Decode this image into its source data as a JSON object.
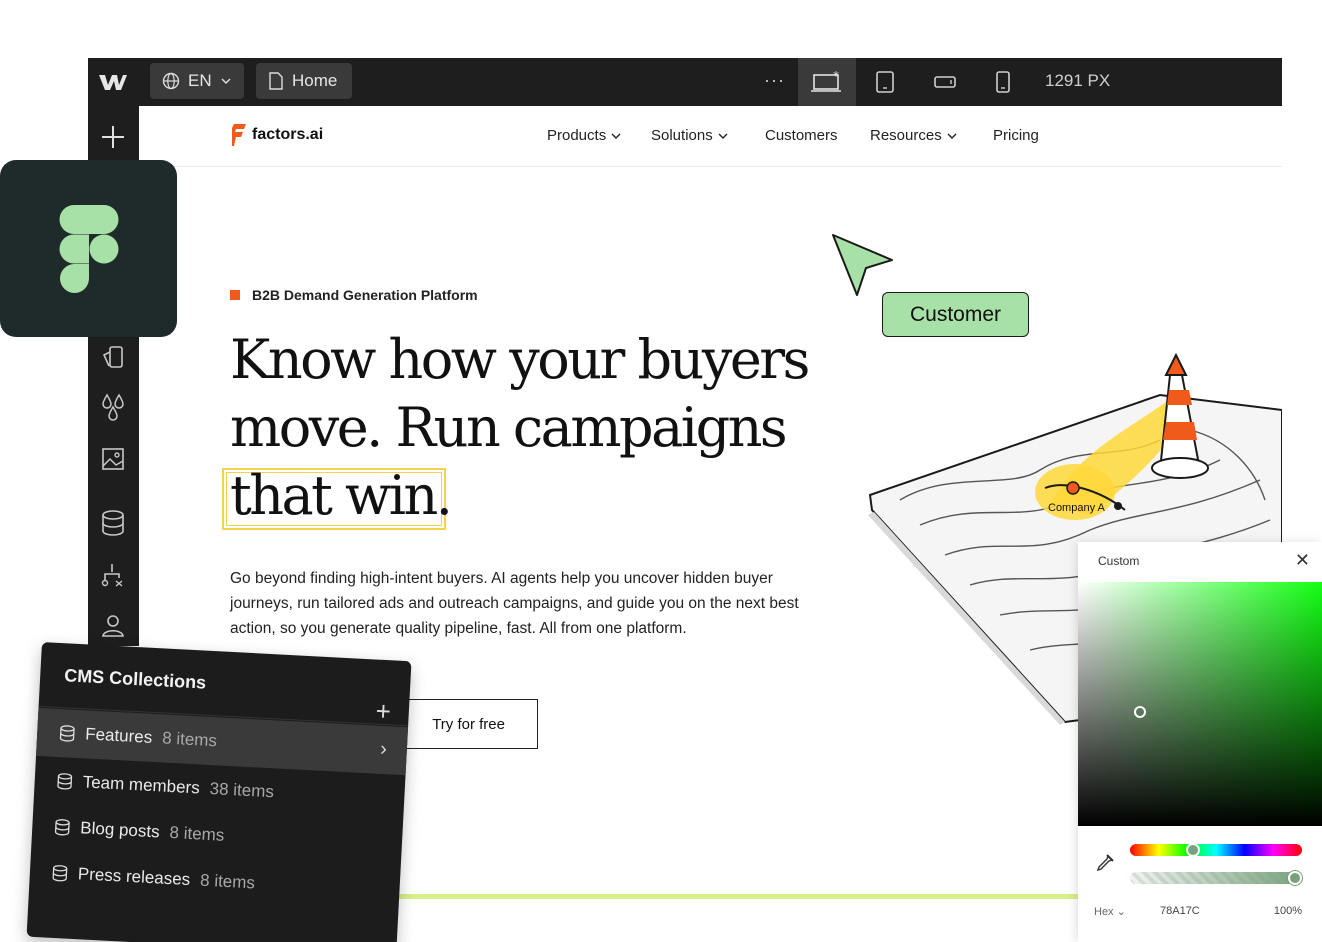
{
  "toolbar": {
    "language": "EN",
    "page": "Home",
    "more": "···",
    "width_readout": "1291 PX"
  },
  "site": {
    "brand": "factors.ai",
    "nav": [
      "Products",
      "Solutions",
      "Customers",
      "Resources",
      "Pricing"
    ],
    "eyebrow": "B2B Demand Generation Platform",
    "headline_line1": "Know how your buyers",
    "headline_line2": "move. Run campaigns",
    "headline_line3": "that win.",
    "body": "Go beyond finding high-intent buyers. AI agents help you uncover hidden buyer journeys, run tailored ads and outreach campaigns, and guide you on the next best action, so you generate quality pipeline, fast. All from one platform.",
    "cta": "Try for free",
    "customer_tag": "Customer",
    "map_label": "Company A"
  },
  "cms": {
    "title": "CMS Collections",
    "items": [
      {
        "name": "Features",
        "count": "8 items"
      },
      {
        "name": "Team members",
        "count": "38 items"
      },
      {
        "name": "Blog posts",
        "count": "8 items"
      },
      {
        "name": "Press releases",
        "count": "8 items"
      }
    ]
  },
  "picker": {
    "title": "Custom",
    "mode": "Hex",
    "hex": "78A17C",
    "opacity": "100%",
    "color": "#78A17C"
  }
}
